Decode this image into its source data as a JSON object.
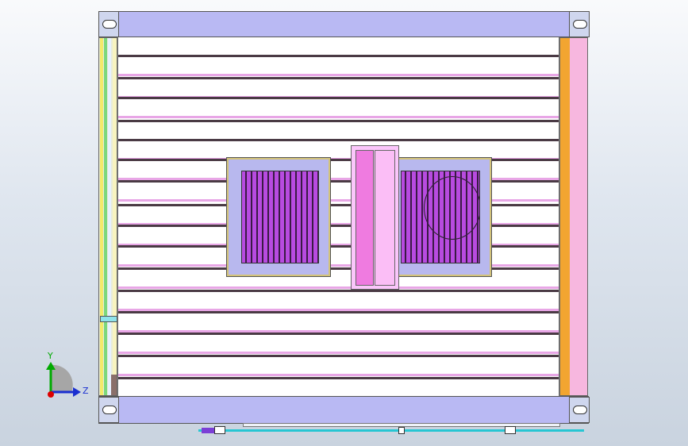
{
  "viewport": {
    "name": "cad-top-view",
    "colors": {
      "rail": "#b9b9f3",
      "deck": "#ffffff",
      "slat_dark": "#4a3a44",
      "slat_pink": "#e8a6e6",
      "grille": "#b84be0",
      "orange": "#f2a531",
      "pink": "#f7b7df",
      "cyan": "#27c6d3",
      "yellow": "#f4ea6a"
    }
  },
  "triad": {
    "y_label": "Y",
    "z_label": "Z"
  }
}
